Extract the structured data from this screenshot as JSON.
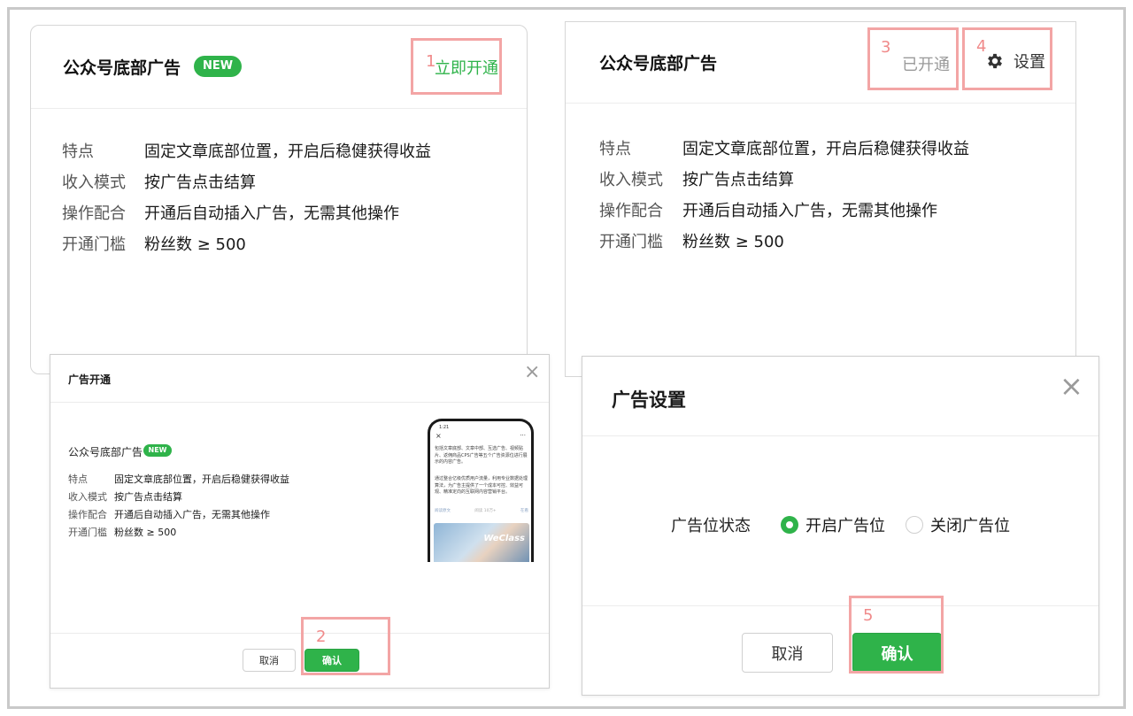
{
  "card_left": {
    "title": "公众号底部广告",
    "badge": "NEW",
    "action": "立即开通",
    "rows": [
      {
        "label": "特点",
        "value": "固定文章底部位置，开启后稳健获得收益"
      },
      {
        "label": "收入模式",
        "value": "按广告点击结算"
      },
      {
        "label": "操作配合",
        "value": "开通后自动插入广告，无需其他操作"
      },
      {
        "label": "开通门槛",
        "value": "粉丝数 ≥ 500"
      }
    ]
  },
  "card_right": {
    "title": "公众号底部广告",
    "status": "已开通",
    "settings_label": "设置",
    "rows": [
      {
        "label": "特点",
        "value": "固定文章底部位置，开启后稳健获得收益"
      },
      {
        "label": "收入模式",
        "value": "按广告点击结算"
      },
      {
        "label": "操作配合",
        "value": "开通后自动插入广告，无需其他操作"
      },
      {
        "label": "开通门槛",
        "value": "粉丝数 ≥ 500"
      }
    ]
  },
  "dialog_open": {
    "title": "广告开通",
    "close": "×",
    "ad_title": "公众号底部广告",
    "badge": "NEW",
    "rows": [
      {
        "label": "特点",
        "value": "固定文章底部位置，开启后稳健获得收益"
      },
      {
        "label": "收入模式",
        "value": "按广告点击结算"
      },
      {
        "label": "操作配合",
        "value": "开通后自动插入广告，无需其他操作"
      },
      {
        "label": "开通门槛",
        "value": "粉丝数 ≥ 500"
      }
    ],
    "cancel": "取消",
    "confirm": "确认",
    "phone": {
      "time": "1:21",
      "close": "×",
      "more": "···",
      "paragraph1": "包括文章底部、文章中部、互选广告、视频贴片、返佣商品CPS广告等五个广告资源位进行展示的内容广告。",
      "paragraph2": "通过整合亿级优质用户流量，利用专业数据处理算法，为广告主提供了一个成本可控、效益可观、精准定向的互联网内容营销平台。",
      "meta_left": "阅读原文",
      "meta_mid": "阅读 10万+",
      "meta_right": "在看",
      "brand": "WeClass"
    }
  },
  "dialog_settings": {
    "title": "广告设置",
    "close": "×",
    "status_label": "广告位状态",
    "option_on": "开启广告位",
    "option_off": "关闭广告位",
    "cancel": "取消",
    "confirm": "确认"
  },
  "annotations": [
    "1",
    "2",
    "3",
    "4",
    "5"
  ]
}
